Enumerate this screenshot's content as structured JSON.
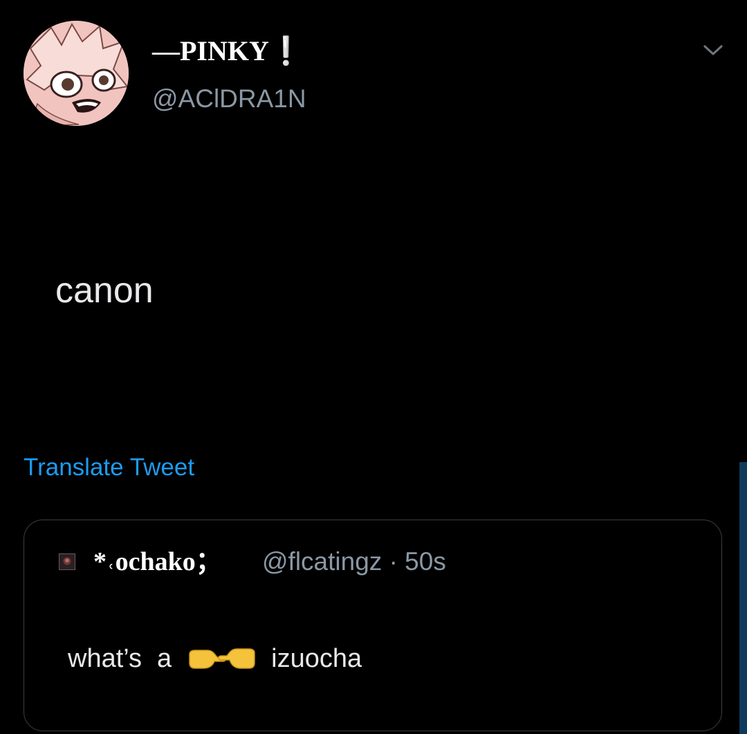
{
  "tweet": {
    "author": {
      "display_name": "––PINKY❕",
      "handle": "@AClDRA1N"
    },
    "text": "canon",
    "translate_label": "Translate Tweet"
  },
  "quote": {
    "author_name": "*˓ochako；",
    "handle_time": "@flcatingz · 50s",
    "text_before": "what’s",
    "text_a": "a",
    "emoji_label": "👉👈",
    "text_after": "izuocha"
  },
  "colors": {
    "background": "#000000",
    "link": "#1d9bf0",
    "secondary_text": "#8b98a5",
    "card_border": "#3a3f44"
  },
  "icons": {
    "more": "chevron-down-icon",
    "emoji": "pointing-fingers-emoji"
  }
}
